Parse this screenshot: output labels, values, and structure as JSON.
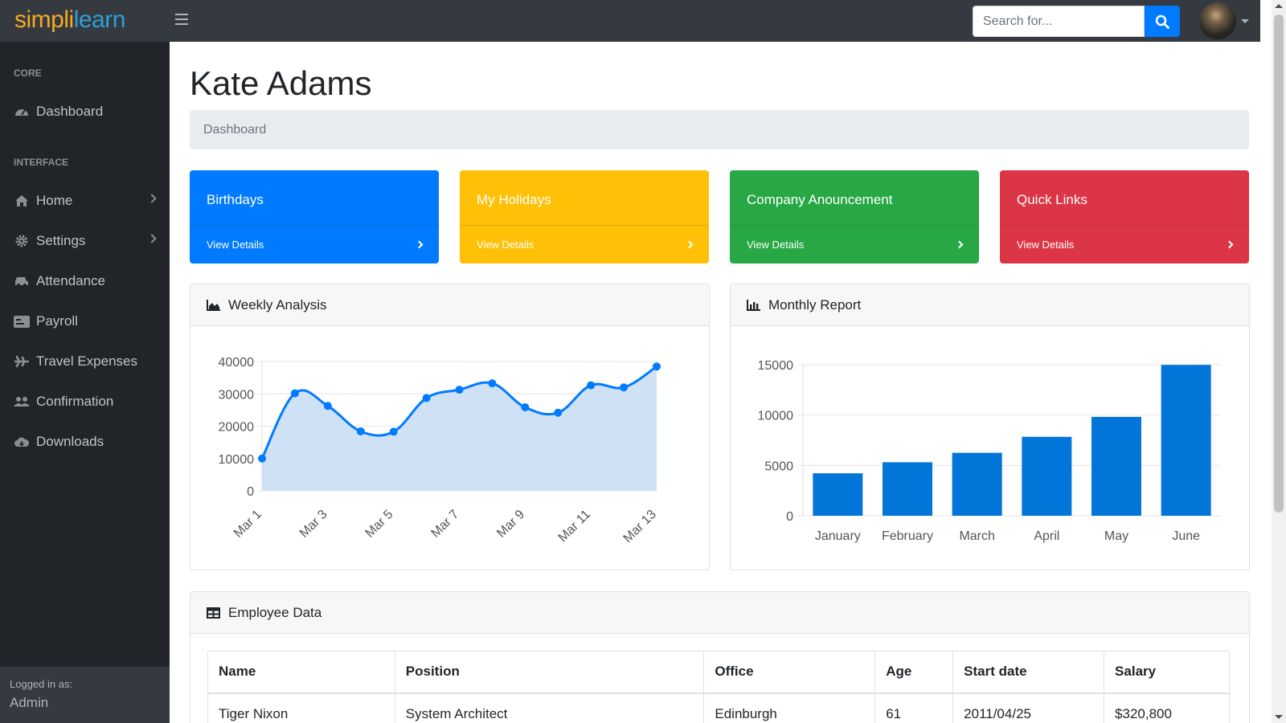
{
  "navbar": {
    "brand_part1": "simpl",
    "brand_bar": "i",
    "brand_part2": "learn",
    "search_placeholder": "Search for...",
    "menu_icon": "hamburger-icon",
    "search_icon": "search-icon"
  },
  "sidebar": {
    "core_heading": "CORE",
    "interface_heading": "INTERFACE",
    "items": [
      {
        "label": "Dashboard",
        "icon": "tachometer-icon"
      },
      {
        "label": "Home",
        "icon": "home-icon"
      },
      {
        "label": "Settings",
        "icon": "gear-icon"
      },
      {
        "label": "Attendance",
        "icon": "car-icon"
      },
      {
        "label": "Payroll",
        "icon": "card-icon"
      },
      {
        "label": "Travel Expenses",
        "icon": "plane-icon"
      },
      {
        "label": "Confirmation",
        "icon": "users-icon"
      },
      {
        "label": "Downloads",
        "icon": "cloud-download-icon"
      }
    ],
    "footer_label": "Logged in as:",
    "footer_user": "Admin"
  },
  "page": {
    "title": "Kate Adams",
    "breadcrumb": "Dashboard"
  },
  "cards": [
    {
      "title": "Birthdays",
      "link": "View Details",
      "color": "#007bff"
    },
    {
      "title": "My Holidays",
      "link": "View Details",
      "color": "#ffc107"
    },
    {
      "title": "Company Anouncement",
      "link": "View Details",
      "color": "#28a745"
    },
    {
      "title": "Quick Links",
      "link": "View Details",
      "color": "#dc3545"
    }
  ],
  "weekly": {
    "header": "Weekly Analysis"
  },
  "monthly": {
    "header": "Monthly Report"
  },
  "employee": {
    "header": "Employee Data",
    "columns": [
      "Name",
      "Position",
      "Office",
      "Age",
      "Start date",
      "Salary"
    ],
    "rows": [
      [
        "Tiger Nixon",
        "System Architect",
        "Edinburgh",
        "61",
        "2011/04/25",
        "$320,800"
      ]
    ]
  },
  "chart_data": [
    {
      "type": "area",
      "x": [
        "Mar 1",
        "Mar 2",
        "Mar 3",
        "Mar 4",
        "Mar 5",
        "Mar 6",
        "Mar 7",
        "Mar 8",
        "Mar 9",
        "Mar 10",
        "Mar 11",
        "Mar 12",
        "Mar 13"
      ],
      "tick_labels": [
        "Mar 1",
        "Mar 3",
        "Mar 5",
        "Mar 7",
        "Mar 9",
        "Mar 11",
        "Mar 13"
      ],
      "values": [
        10000,
        30162,
        26263,
        18394,
        18287,
        28682,
        31274,
        33259,
        25849,
        24159,
        32651,
        31984,
        38451
      ],
      "yticks": [
        0,
        10000,
        20000,
        30000,
        40000
      ],
      "ylim": [
        0,
        40000
      ],
      "grid": true,
      "line_color": "#007bff",
      "fill_color": "#cfe1f5"
    },
    {
      "type": "bar",
      "categories": [
        "January",
        "February",
        "March",
        "April",
        "May",
        "June"
      ],
      "values": [
        4215,
        5312,
        6251,
        7841,
        9821,
        14984
      ],
      "yticks": [
        0,
        5000,
        10000,
        15000
      ],
      "ylim": [
        0,
        15000
      ],
      "grid": true,
      "bar_color": "#0275d8"
    }
  ]
}
